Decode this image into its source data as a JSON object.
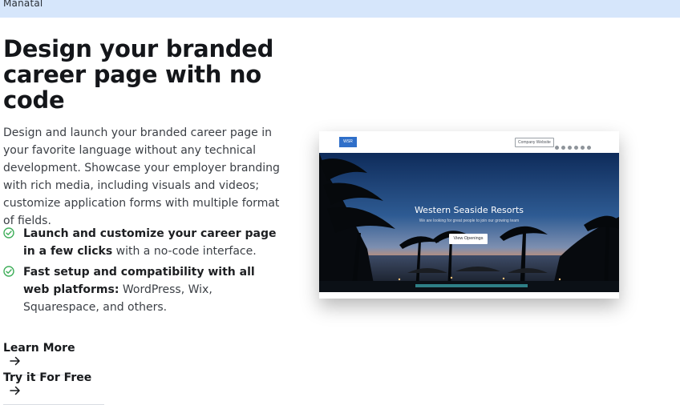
{
  "topbar": {
    "brand": "Manatal"
  },
  "hero": {
    "headline": "Design your branded career page with no code",
    "description": "Design and launch your branded career page in your favorite language without any technical development. Showcase your employer branding with rich media, including visuals and videos; customize application forms with multiple format of fields."
  },
  "features": [
    {
      "bold": "Launch and customize your career page in a few clicks",
      "rest": " with a no-code interface."
    },
    {
      "bold": "Fast setup and compatibility with all web platforms:",
      "rest": " WordPress, Wix, Squarespace, and others."
    }
  ],
  "links": {
    "learn_more": "Learn More",
    "try_free": "Try it For Free"
  },
  "preview": {
    "company_website_button": "Company Website",
    "title": "Western Seaside Resorts",
    "subtitle": "We are looking for great people to join our growing team",
    "cta": "View Openings",
    "social_icons": [
      "facebook-icon",
      "twitter-icon",
      "pinterest-icon",
      "youtube-icon",
      "instagram-icon",
      "linkedin-icon"
    ]
  },
  "colors": {
    "topbar": "#d6e6fb",
    "check": "#3fae5a",
    "heading": "#14161a"
  }
}
